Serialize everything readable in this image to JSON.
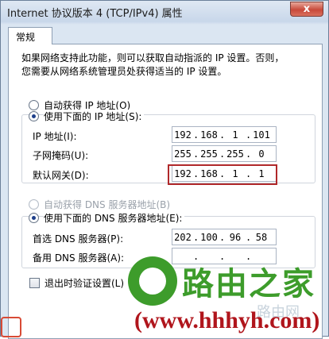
{
  "window": {
    "title": "Internet 协议版本 4 (TCP/IPv4) 属性",
    "close_label": "x"
  },
  "tabs": [
    {
      "label": "常规"
    }
  ],
  "description": {
    "line1": "如果网络支持此功能，则可以获取自动指派的 IP 设置。否则，",
    "line2": "您需要从网络系统管理员处获得适当的 IP 设置。"
  },
  "ip_mode": {
    "auto_label": "自动获得 IP 地址(O)",
    "manual_label": "使用下面的 IP 地址(S):",
    "selected": "manual"
  },
  "ip_fields": [
    {
      "label": "IP 地址(I):",
      "octets": [
        "192",
        "168",
        "1",
        "101"
      ]
    },
    {
      "label": "子网掩码(U):",
      "octets": [
        "255",
        "255",
        "255",
        "0"
      ]
    },
    {
      "label": "默认网关(D):",
      "octets": [
        "192",
        "168",
        "1",
        "1"
      ]
    }
  ],
  "dns_mode": {
    "auto_label": "自动获得 DNS 服务器地址(B)",
    "manual_label": "使用下面的 DNS 服务器地址(E):",
    "selected": "manual"
  },
  "dns_fields": [
    {
      "label": "首选 DNS 服务器(P):",
      "octets": [
        "202",
        "100",
        "96",
        "58"
      ]
    },
    {
      "label": "备用 DNS 服务器(A):",
      "octets": [
        "",
        "",
        "",
        ""
      ]
    }
  ],
  "validate_on_exit": {
    "label": "退出时验证设置(L)",
    "checked": false
  },
  "watermark": {
    "brand": "路由之家",
    "url": "(www.hhhyh.com)",
    "small": "路由网"
  },
  "colors": {
    "highlight": "#b0282a",
    "watermark_green": "#3d9c2b",
    "watermark_red": "#b0151c"
  }
}
